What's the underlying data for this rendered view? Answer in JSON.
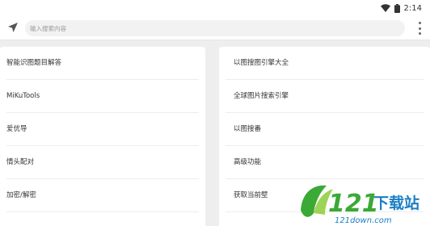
{
  "status_bar": {
    "time": "2:14",
    "wifi_icon": "wifi-icon",
    "battery_icon": "battery-icon"
  },
  "top_bar": {
    "nav_icon": "navigation-arrow-icon",
    "search_placeholder": "输入搜索内容",
    "more_icon": "more-vertical-icon"
  },
  "left_list": [
    {
      "label": "智能识图题目解答"
    },
    {
      "label": "MiKuTools"
    },
    {
      "label": "爱优导"
    },
    {
      "label": "情头配对"
    },
    {
      "label": "加密/解密"
    }
  ],
  "right_list": [
    {
      "label": "以图搜图引擎大全"
    },
    {
      "label": "全球图片搜索引擎"
    },
    {
      "label": "以图搜番"
    },
    {
      "label": "高级功能"
    },
    {
      "label": "获取当前壁"
    }
  ],
  "watermark": {
    "brand_number": "121",
    "brand_text": "下载站",
    "brand_url": "121down.com"
  },
  "colors": {
    "background": "#eeeeee",
    "card": "#ffffff",
    "watermark_green": "#3aa935",
    "watermark_blue": "#1b7fc4"
  }
}
